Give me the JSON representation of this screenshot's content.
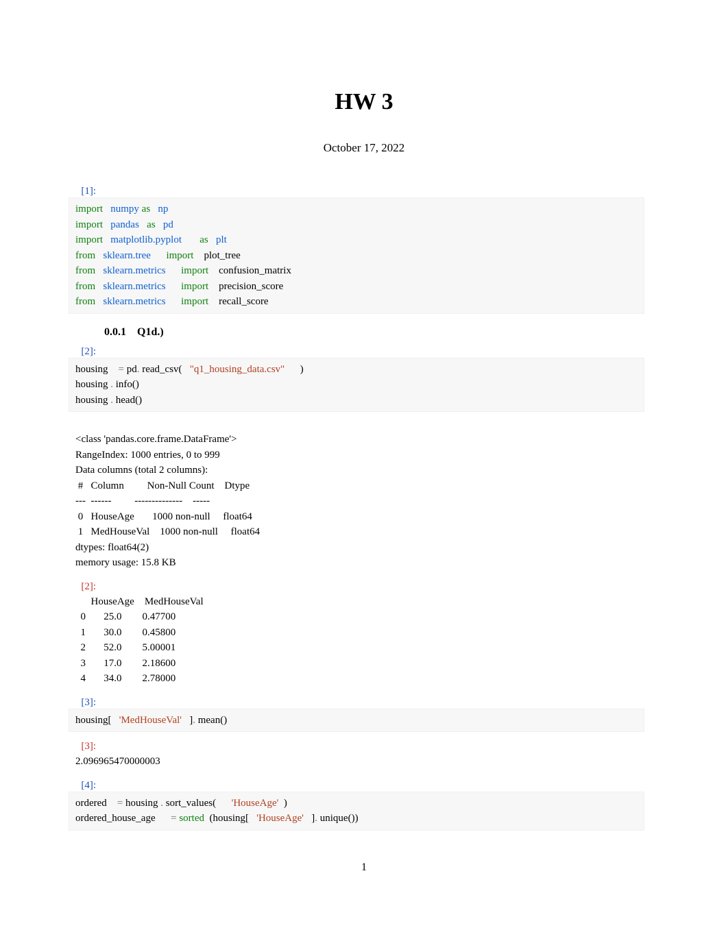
{
  "title": "HW 3",
  "date": "October 17, 2022",
  "section_heading": "0.0.1 Q1d.)",
  "cells": {
    "c1": {
      "prompt": "[1]:",
      "tokens": [
        [
          "kw",
          "import"
        ],
        [
          "plain",
          "   "
        ],
        [
          "mod",
          "numpy"
        ],
        [
          "plain",
          " "
        ],
        [
          "kw",
          "as"
        ],
        [
          "plain",
          "   "
        ],
        [
          "mod",
          "np"
        ],
        [
          "nl",
          ""
        ],
        [
          "kw",
          "import"
        ],
        [
          "plain",
          "   "
        ],
        [
          "mod",
          "pandas"
        ],
        [
          "plain",
          "   "
        ],
        [
          "kw",
          "as"
        ],
        [
          "plain",
          "   "
        ],
        [
          "mod",
          "pd"
        ],
        [
          "nl",
          ""
        ],
        [
          "kw",
          "import"
        ],
        [
          "plain",
          "   "
        ],
        [
          "mod",
          "matplotlib.pyplot"
        ],
        [
          "plain",
          "       "
        ],
        [
          "kw",
          "as"
        ],
        [
          "plain",
          "   "
        ],
        [
          "mod",
          "plt"
        ],
        [
          "nl",
          ""
        ],
        [
          "kw",
          "from"
        ],
        [
          "plain",
          "   "
        ],
        [
          "mod",
          "sklearn.tree"
        ],
        [
          "plain",
          "      "
        ],
        [
          "kw",
          "import"
        ],
        [
          "plain",
          "    "
        ],
        [
          "plain",
          "plot_tree"
        ],
        [
          "nl",
          ""
        ],
        [
          "kw",
          "from"
        ],
        [
          "plain",
          "   "
        ],
        [
          "mod",
          "sklearn.metrics"
        ],
        [
          "plain",
          "      "
        ],
        [
          "kw",
          "import"
        ],
        [
          "plain",
          "    "
        ],
        [
          "plain",
          "confusion_matrix"
        ],
        [
          "nl",
          ""
        ],
        [
          "kw",
          "from"
        ],
        [
          "plain",
          "   "
        ],
        [
          "mod",
          "sklearn.metrics"
        ],
        [
          "plain",
          "      "
        ],
        [
          "kw",
          "import"
        ],
        [
          "plain",
          "    "
        ],
        [
          "plain",
          "precision_score"
        ],
        [
          "nl",
          ""
        ],
        [
          "kw",
          "from"
        ],
        [
          "plain",
          "   "
        ],
        [
          "mod",
          "sklearn.metrics"
        ],
        [
          "plain",
          "      "
        ],
        [
          "kw",
          "import"
        ],
        [
          "plain",
          "    "
        ],
        [
          "plain",
          "recall_score"
        ]
      ]
    },
    "c2": {
      "prompt": "[2]:",
      "tokens": [
        [
          "plain",
          "housing"
        ],
        [
          "plain",
          "    "
        ],
        [
          "op",
          "="
        ],
        [
          "plain",
          " pd"
        ],
        [
          "op",
          "."
        ],
        [
          "plain",
          " read_csv("
        ],
        [
          "plain",
          "   "
        ],
        [
          "str",
          "\"q1_housing_data.csv\""
        ],
        [
          "plain",
          "      )"
        ],
        [
          "nl",
          ""
        ],
        [
          "plain",
          "housing "
        ],
        [
          "op",
          "."
        ],
        [
          "plain",
          " info()"
        ],
        [
          "nl",
          ""
        ],
        [
          "plain",
          "housing "
        ],
        [
          "op",
          "."
        ],
        [
          "plain",
          " head()"
        ]
      ]
    },
    "c2out_text": "<class 'pandas.core.frame.DataFrame'>\nRangeIndex: 1000 entries, 0 to 999\nData columns (total 2 columns):\n #   Column         Non-Null Count    Dtype\n---  ------         --------------    -----\n 0   HouseAge       1000 non-null     float64\n 1   MedHouseVal    1000 non-null     float64\ndtypes: float64(2)\nmemory usage: 15.8 KB",
    "c2out": {
      "prompt": "[2]:",
      "text": "      HouseAge    MedHouseVal\n  0       25.0        0.47700\n  1       30.0        0.45800\n  2       52.0        5.00001\n  3       17.0        2.18600\n  4       34.0        2.78000"
    },
    "c3": {
      "prompt": "[3]:",
      "tokens": [
        [
          "plain",
          "housing["
        ],
        [
          "plain",
          "   "
        ],
        [
          "str",
          "'MedHouseVal'"
        ],
        [
          "plain",
          "   ]"
        ],
        [
          "op",
          "."
        ],
        [
          "plain",
          " mean()"
        ]
      ]
    },
    "c3out": {
      "prompt": "[3]:",
      "text": "2.096965470000003"
    },
    "c4": {
      "prompt": "[4]:",
      "tokens": [
        [
          "plain",
          "ordered"
        ],
        [
          "plain",
          "    "
        ],
        [
          "op",
          "="
        ],
        [
          "plain",
          " housing "
        ],
        [
          "op",
          "."
        ],
        [
          "plain",
          " sort_values("
        ],
        [
          "plain",
          "      "
        ],
        [
          "str",
          "'HouseAge'"
        ],
        [
          "plain",
          "  )"
        ],
        [
          "nl",
          ""
        ],
        [
          "plain",
          "ordered_house_age"
        ],
        [
          "plain",
          "      "
        ],
        [
          "op",
          "="
        ],
        [
          "plain",
          " "
        ],
        [
          "builtin",
          "sorted"
        ],
        [
          "plain",
          "  (housing["
        ],
        [
          "plain",
          "   "
        ],
        [
          "str",
          "'HouseAge'"
        ],
        [
          "plain",
          "   ]"
        ],
        [
          "op",
          "."
        ],
        [
          "plain",
          " unique())"
        ]
      ]
    }
  },
  "page_number": "1"
}
